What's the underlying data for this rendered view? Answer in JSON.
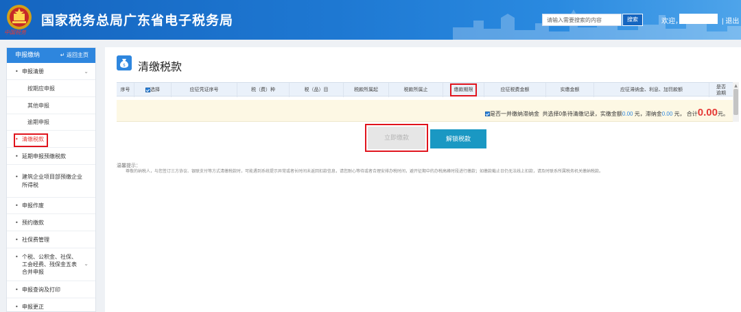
{
  "header": {
    "title": "国家税务总局广东省电子税务局",
    "emblem_caption": "中国税务",
    "search_placeholder": "请输入需要搜索的内容",
    "search_button": "搜索",
    "welcome": "欢迎，",
    "separator": "|",
    "logout": "退出"
  },
  "sidebar": {
    "title": "申报缴纳",
    "home_link": "返回主页",
    "items": [
      {
        "label": "申报清册"
      },
      {
        "label": "按期应申报"
      },
      {
        "label": "其他申报"
      },
      {
        "label": "逾期申报"
      },
      {
        "label": "清缴税款"
      },
      {
        "label": "延期申报预缴税款"
      },
      {
        "label": "建筑企业项目部预缴企业所得税"
      },
      {
        "label": "申报作废"
      },
      {
        "label": "预约缴款"
      },
      {
        "label": "社保费管理"
      },
      {
        "label": "个税、公积金、社保、工会经费、残保金五表合并申报"
      },
      {
        "label": "申报查询及打印"
      },
      {
        "label": "申报更正"
      }
    ]
  },
  "main": {
    "page_title": "清缴税款",
    "columns": [
      "序号",
      "选择",
      "应征凭证序号",
      "税（费）种",
      "税（品）目",
      "税款所属起",
      "税款所属止",
      "缴款期限",
      "应征税费金额",
      "实缴金额",
      "应征滞纳金、利息、加罚款额",
      "是否逾期"
    ],
    "summary": {
      "checkbox_label": "是否一并缴纳滞纳金",
      "text1": "共选择0条待清缴记录，实缴金额",
      "paid_amount": "0.00",
      "yuan1": "元，滞纳金",
      "late_fee": "0.00",
      "yuan2": "元，",
      "total_label": "合计",
      "total": "0.00",
      "yuan3": "元。"
    },
    "pay_button": "立即缴款",
    "unlock_button": "解锁税款",
    "tip_title": "温馨提示：",
    "tip_body": "尊敬的纳税人，与您签订三方协议、银联支付等方式清缴税款时，可能遇到系统提示异常或者长时间未返回扣款信息，请您耐心等待或者合理安排办税时间，避开征期中的办税高峰时段进行缴款；如缴款截止日仍无法线上扣款，请及时联系所属税务机关缴纳税款。"
  },
  "colors": {
    "header_blue": "#1e78d2",
    "accent": "#2e86de",
    "highlight_red": "#e0121b",
    "total_red": "#e53935",
    "unlock_teal": "#1a98c3"
  }
}
